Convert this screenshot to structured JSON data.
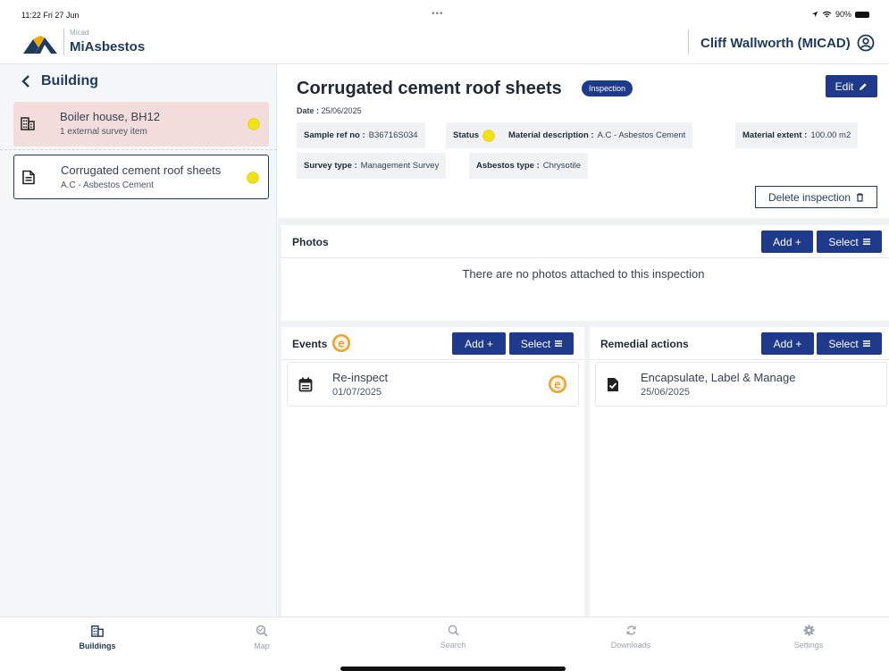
{
  "status_bar": {
    "time": "11:22  Fri 27 Jun",
    "dots": "•••",
    "battery": "90%"
  },
  "header": {
    "logo_small": "Micad",
    "logo_name": "MiAsbestos",
    "user_name": "Cliff Wallworth (MICAD)"
  },
  "sidebar": {
    "back_label": "Building",
    "building": {
      "title": "Boiler house, BH12",
      "subtitle": "1 external survey item"
    },
    "selected_item": {
      "title": "Corrugated cement roof sheets",
      "subtitle": "A.C - Asbestos Cement"
    }
  },
  "inspection": {
    "title": "Corrugated cement roof sheets",
    "badge": "Inspection",
    "edit_label": "Edit",
    "date_label": "Date :",
    "date_value": "25/06/2025",
    "sample_ref_label": "Sample ref no :",
    "sample_ref_value": "B36716S034",
    "status_label": "Status",
    "material_desc_label": "Material description :",
    "material_desc_value": "A.C - Asbestos Cement",
    "material_extent_label": "Material extent :",
    "material_extent_value": "100.00 m2",
    "survey_type_label": "Survey type :",
    "survey_type_value": "Management Survey",
    "asbestos_type_label": "Asbestos type :",
    "asbestos_type_value": "Chrysotile",
    "delete_label": "Delete inspection"
  },
  "photos": {
    "title": "Photos",
    "add_label": "Add +",
    "select_label": "Select",
    "empty_text": "There are no photos attached to this inspection"
  },
  "events": {
    "title": "Events",
    "badge_letter": "e",
    "add_label": "Add +",
    "select_label": "Select",
    "items": [
      {
        "title": "Re-inspect",
        "date": "01/07/2025"
      }
    ]
  },
  "remedial": {
    "title": "Remedial actions",
    "add_label": "Add +",
    "select_label": "Select",
    "items": [
      {
        "title": "Encapsulate, Label & Manage",
        "date": "25/06/2025"
      }
    ]
  },
  "tabs": [
    {
      "label": "Buildings",
      "icon": "building-icon",
      "active": true
    },
    {
      "label": "Map",
      "icon": "map-icon"
    },
    {
      "label": "Search",
      "icon": "search-icon"
    },
    {
      "label": "Downloads",
      "icon": "sync-icon"
    },
    {
      "label": "Settings",
      "icon": "gear-icon"
    }
  ],
  "colors": {
    "primary": "#1f3a8a",
    "brand_navy": "#1f3a5f",
    "status_yellow": "#f5e400",
    "event_orange": "#f0a030",
    "building_highlight": "#f3dcdc"
  }
}
